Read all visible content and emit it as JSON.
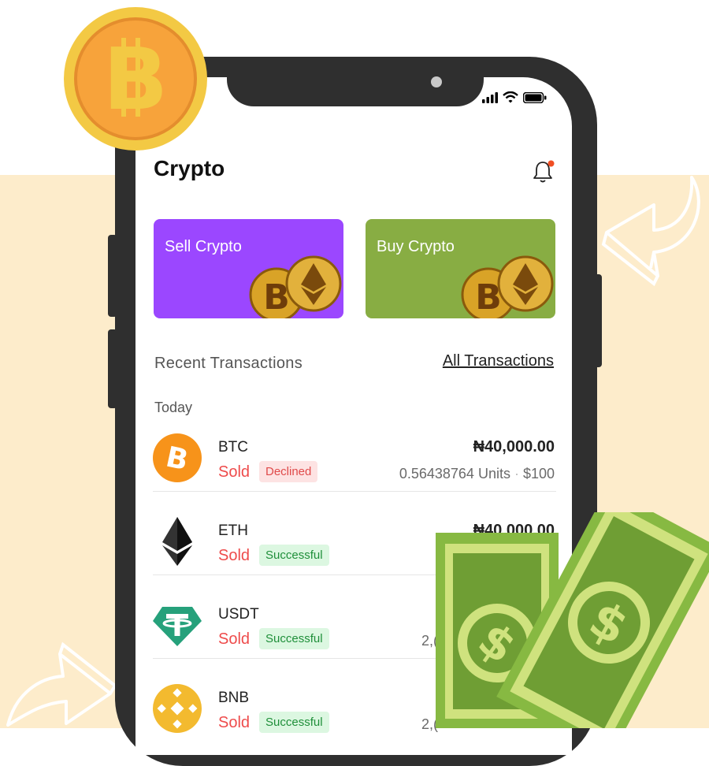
{
  "app": {
    "title": "Crypto"
  },
  "actions": {
    "sell": "Sell Crypto",
    "buy": "Buy Crypto"
  },
  "transactions": {
    "heading": "Recent Transactions",
    "all_link": "All Transactions",
    "group": "Today",
    "items": [
      {
        "symbol": "BTC",
        "action": "Sold",
        "status": "Declined",
        "amount": "₦40,000.00",
        "units": "0.56438764 Units",
        "usd": "$100"
      },
      {
        "symbol": "ETH",
        "action": "Sold",
        "status": "Successful",
        "amount": "₦40,000.00"
      },
      {
        "symbol": "USDT",
        "action": "Sold",
        "status": "Successful",
        "units": "2,("
      },
      {
        "symbol": "BNB",
        "action": "Sold",
        "status": "Successful",
        "units": "2,("
      }
    ]
  },
  "colors": {
    "sell_card": "#9b47ff",
    "buy_card": "#88ad43",
    "btc": "#f7931a",
    "usdt": "#26a17b",
    "bnb": "#f3ba2f",
    "declined": "#e04a4a",
    "successful": "#1f8f3a"
  }
}
